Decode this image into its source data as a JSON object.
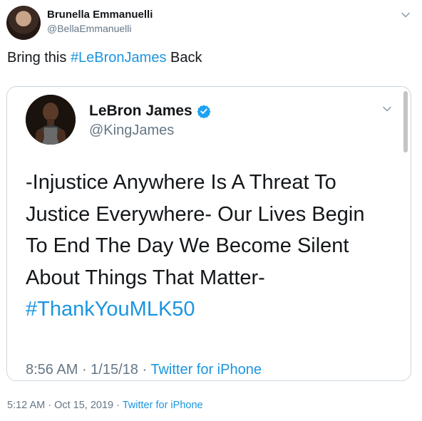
{
  "tweet": {
    "author": {
      "name": "Brunella Emmanuelli",
      "handle": "@BellaEmmanuelli"
    },
    "text_prefix": "Bring this ",
    "hashtag": "#LeBronJames",
    "text_suffix": " Back",
    "meta": {
      "time": "5:12 AM",
      "separator": " · ",
      "date": "Oct 15, 2019",
      "separator2": " · ",
      "source": "Twitter for iPhone"
    }
  },
  "embedded": {
    "author": {
      "name": "LeBron James",
      "handle": "@KingJames",
      "verified": true
    },
    "text": "-Injustice Anywhere Is A Threat To\nJustice Everywhere-  Our Lives Begin\nTo End The Day We Become Silent\nAbout Things That Matter-",
    "hashtag": "#ThankYouMLK50",
    "meta": {
      "time": "8:56 AM",
      "separator": " · ",
      "date": "1/15/18",
      "separator2": " · ",
      "source": "Twitter for iPhone"
    }
  },
  "icons": [
    "chevron-down-icon",
    "verified-badge-icon"
  ],
  "colors": {
    "link": "#1b95e0",
    "secondary": "#657786",
    "text": "#14171a",
    "border": "#ccd6dd",
    "verified": "#1da1f2"
  }
}
